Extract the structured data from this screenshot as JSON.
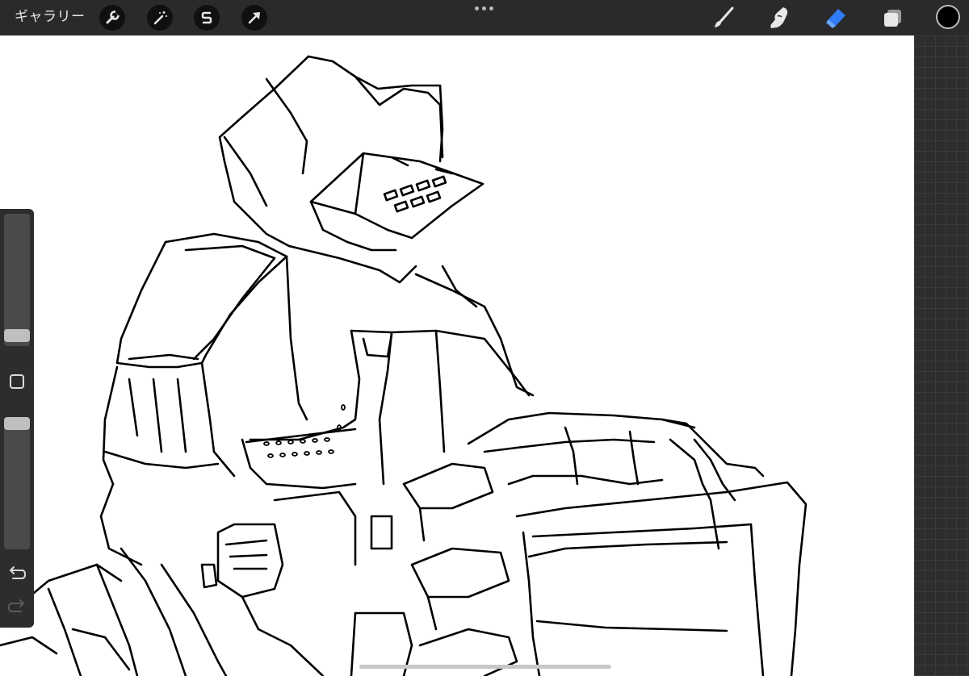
{
  "toolbar": {
    "gallery_label": "ギャラリー",
    "left_tools": [
      {
        "name": "actions",
        "icon": "wrench-icon"
      },
      {
        "name": "adjustments",
        "icon": "magic-wand-icon"
      },
      {
        "name": "selection",
        "icon": "selection-s-icon"
      },
      {
        "name": "transform",
        "icon": "arrow-cursor-icon"
      }
    ],
    "more_icon": "ellipsis-icon",
    "right_tools": [
      {
        "name": "brush",
        "icon": "brush-icon",
        "active": false
      },
      {
        "name": "smudge",
        "icon": "smudge-finger-icon",
        "active": false
      },
      {
        "name": "eraser",
        "icon": "eraser-icon",
        "active": true
      },
      {
        "name": "layers",
        "icon": "layers-icon",
        "active": false
      }
    ],
    "current_color": "#000000",
    "active_tool_color": "#2f7cf6"
  },
  "sidebar": {
    "brush_size_level": 0.1,
    "opacity_level": 0.9,
    "modify_icon": "square-modify-icon",
    "undo_icon": "undo-arrow-icon",
    "redo_icon": "redo-arrow-icon"
  },
  "canvas": {
    "background": "#ffffff",
    "stroke_color": "#000000"
  }
}
